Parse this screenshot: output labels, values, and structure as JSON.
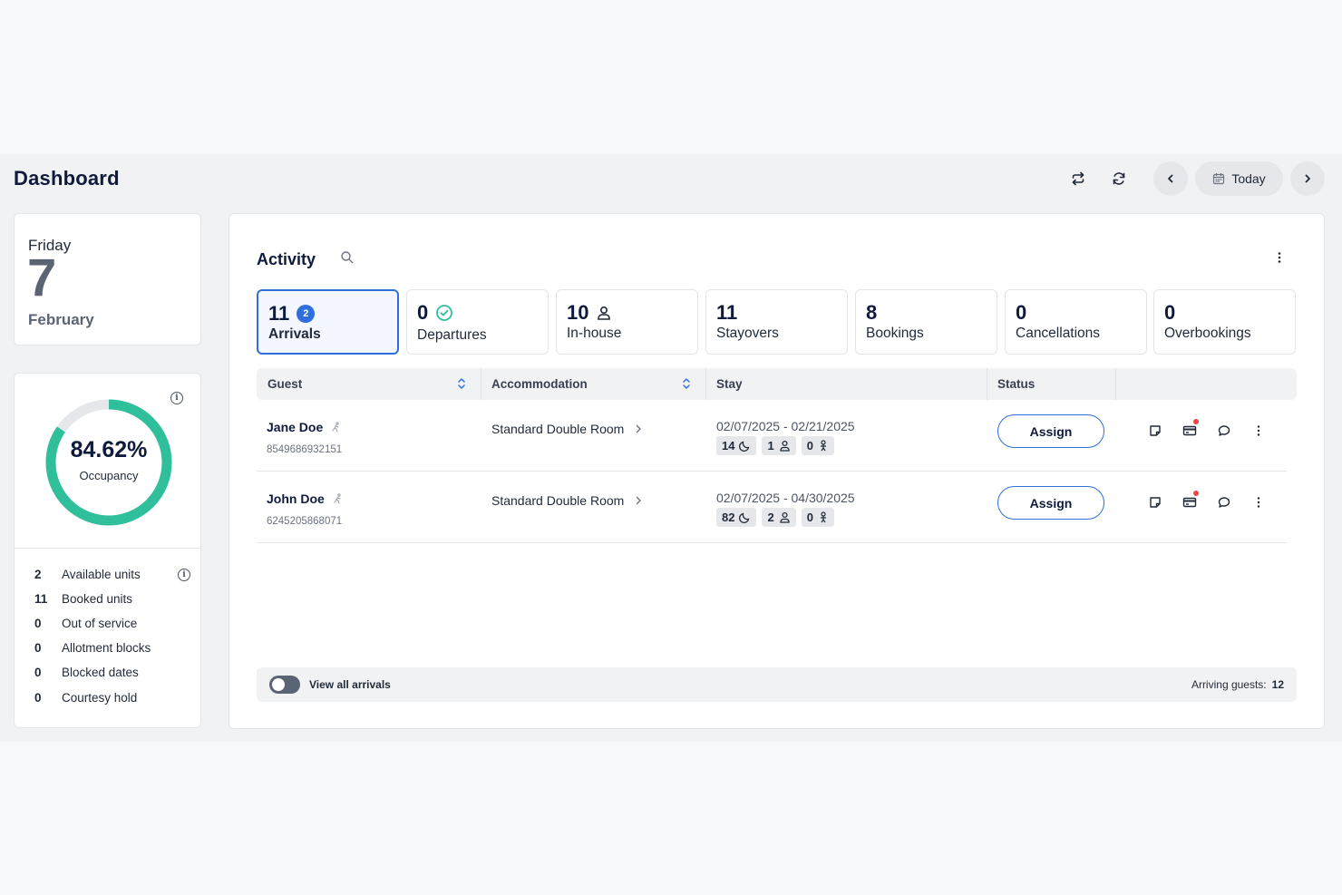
{
  "header": {
    "title": "Dashboard",
    "today_label": "Today"
  },
  "date_card": {
    "weekday": "Friday",
    "day": "7",
    "month": "February"
  },
  "occupancy": {
    "value_text": "84.62%",
    "value_fraction": 0.8462,
    "label": "Occupancy",
    "ring_color": "#2fbf9a",
    "track_color": "#e5e7eb",
    "stats": [
      {
        "count": "2",
        "label": "Available units"
      },
      {
        "count": "11",
        "label": "Booked units"
      },
      {
        "count": "0",
        "label": "Out of service"
      },
      {
        "count": "0",
        "label": "Allotment blocks"
      },
      {
        "count": "0",
        "label": "Blocked dates"
      },
      {
        "count": "0",
        "label": "Courtesy hold"
      }
    ]
  },
  "activity": {
    "title": "Activity",
    "tiles": [
      {
        "count": "11",
        "label": "Arrivals",
        "badge": "2",
        "active": true
      },
      {
        "count": "0",
        "label": "Departures",
        "icon": "check-circle-icon"
      },
      {
        "count": "10",
        "label": "In-house",
        "icon": "person-icon"
      },
      {
        "count": "11",
        "label": "Stayovers"
      },
      {
        "count": "8",
        "label": "Bookings"
      },
      {
        "count": "0",
        "label": "Cancellations"
      },
      {
        "count": "0",
        "label": "Overbookings"
      }
    ],
    "columns": {
      "guest": "Guest",
      "accommodation": "Accommodation",
      "stay": "Stay",
      "status": "Status"
    },
    "rows": [
      {
        "name": "Jane Doe",
        "phone": "8549686932151",
        "accommodation": "Standard Double Room",
        "dates": "02/07/2025 - 02/21/2025",
        "nights": "14",
        "adults": "1",
        "children": "0",
        "action": "Assign"
      },
      {
        "name": "John Doe",
        "phone": "6245205868071",
        "accommodation": "Standard Double Room",
        "dates": "02/07/2025 - 04/30/2025",
        "nights": "82",
        "adults": "2",
        "children": "0",
        "action": "Assign"
      }
    ],
    "footer": {
      "toggle_label": "View all arrivals",
      "arriving_label": "Arriving guests:",
      "arriving_count": "12"
    }
  },
  "colors": {
    "accent": "#2f6fdd",
    "title": "#0f1b3d",
    "notification": "#ef4444"
  }
}
